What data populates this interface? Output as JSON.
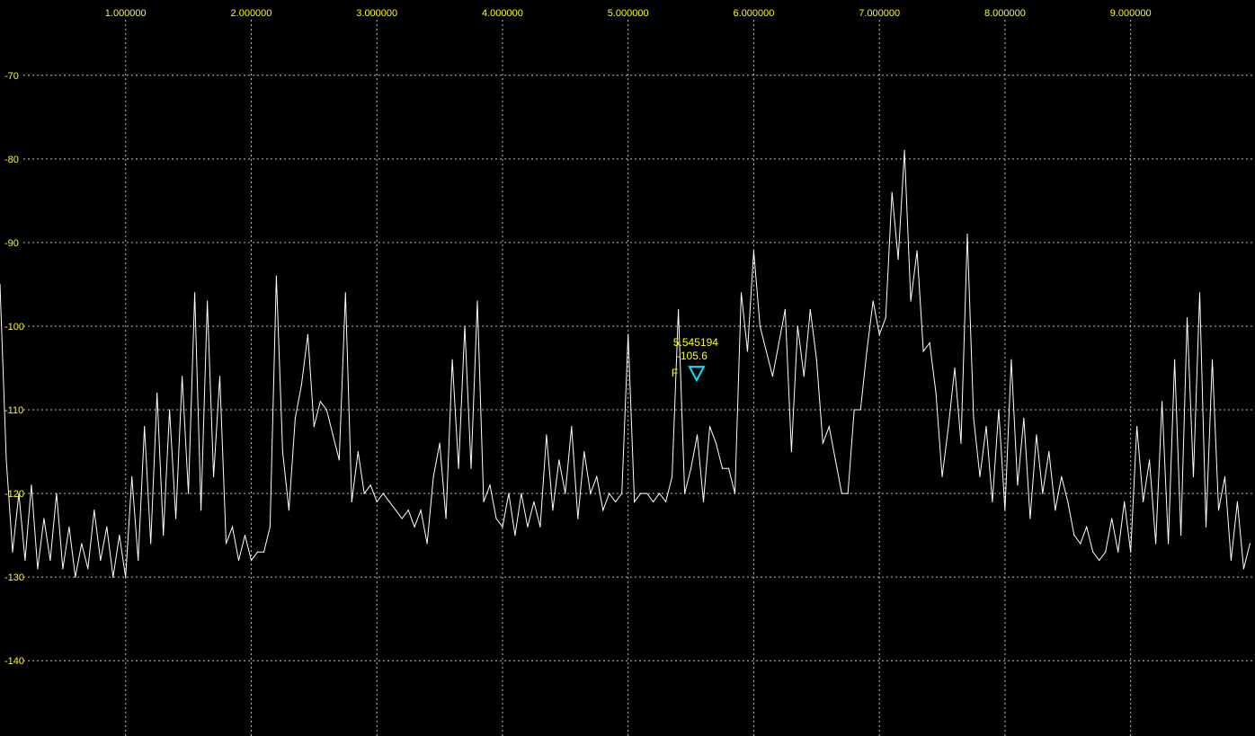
{
  "chart_data": {
    "type": "line",
    "title": "",
    "xlabel": "",
    "ylabel": "",
    "xlim": [
      0.0,
      9.99
    ],
    "ylim": [
      -149.0,
      -61.0
    ],
    "grid": true,
    "x_ticks": [
      "1.000000",
      "2.000000",
      "3.000000",
      "4.000000",
      "5.000000",
      "6.000000",
      "7.000000",
      "8.000000",
      "9.000000"
    ],
    "y_ticks": [
      "-70",
      "-80",
      "-90",
      "-100",
      "-110",
      "-120",
      "-130",
      "-140"
    ],
    "colors": {
      "background": "#000000",
      "trace": "#ffffff",
      "grid": "#bdbdbd",
      "ticks": "#ffff00",
      "marker": "#00e5ff",
      "marker_text": "#ffff00"
    },
    "series": [
      {
        "x": [
          0.0,
          0.05,
          0.1,
          0.15,
          0.2,
          0.25,
          0.3,
          0.35,
          0.4,
          0.45,
          0.5,
          0.55,
          0.6,
          0.65,
          0.7,
          0.75,
          0.8,
          0.85,
          0.9,
          0.95,
          1.0,
          1.05,
          1.1,
          1.15,
          1.2,
          1.25,
          1.3,
          1.35,
          1.4,
          1.45,
          1.5,
          1.55,
          1.6,
          1.65,
          1.7,
          1.75,
          1.8,
          1.85,
          1.9,
          1.95,
          2.0,
          2.05,
          2.1,
          2.15,
          2.2,
          2.25,
          2.3,
          2.35,
          2.4,
          2.45,
          2.5,
          2.55,
          2.6,
          2.65,
          2.7,
          2.75,
          2.8,
          2.85,
          2.9,
          2.95,
          3.0,
          3.05,
          3.1,
          3.15,
          3.2,
          3.25,
          3.3,
          3.35,
          3.4,
          3.45,
          3.5,
          3.55,
          3.6,
          3.65,
          3.7,
          3.75,
          3.8,
          3.85,
          3.9,
          3.95,
          4.0,
          4.05,
          4.1,
          4.15,
          4.2,
          4.25,
          4.3,
          4.35,
          4.4,
          4.45,
          4.5,
          4.55,
          4.6,
          4.65,
          4.7,
          4.75,
          4.8,
          4.85,
          4.9,
          4.95,
          5.0,
          5.05,
          5.1,
          5.15,
          5.2,
          5.25,
          5.3,
          5.35,
          5.4,
          5.45,
          5.5,
          5.55,
          5.6,
          5.65,
          5.7,
          5.75,
          5.8,
          5.85,
          5.9,
          5.95,
          6.0,
          6.05,
          6.1,
          6.15,
          6.2,
          6.25,
          6.3,
          6.35,
          6.4,
          6.45,
          6.5,
          6.55,
          6.6,
          6.65,
          6.7,
          6.75,
          6.8,
          6.85,
          6.9,
          6.95,
          7.0,
          7.05,
          7.1,
          7.15,
          7.2,
          7.25,
          7.3,
          7.35,
          7.4,
          7.45,
          7.5,
          7.55,
          7.6,
          7.65,
          7.7,
          7.75,
          7.8,
          7.85,
          7.9,
          7.95,
          8.0,
          8.05,
          8.1,
          8.15,
          8.2,
          8.25,
          8.3,
          8.35,
          8.4,
          8.45,
          8.5,
          8.55,
          8.6,
          8.65,
          8.7,
          8.75,
          8.8,
          8.85,
          8.9,
          8.95,
          9.0,
          9.05,
          9.1,
          9.15,
          9.2,
          9.25,
          9.3,
          9.35,
          9.4,
          9.45,
          9.5,
          9.55,
          9.6,
          9.65,
          9.7,
          9.75,
          9.8,
          9.85,
          9.9,
          9.95
        ],
        "y": [
          -95,
          -116,
          -127,
          -120,
          -128,
          -119,
          -129,
          -123,
          -128,
          -120,
          -129,
          -124,
          -130,
          -126,
          -129,
          -122,
          -128,
          -124,
          -130,
          -125,
          -130,
          -118,
          -128,
          -112,
          -126,
          -108,
          -125,
          -110,
          -123,
          -106,
          -120,
          -96,
          -122,
          -97,
          -118,
          -106,
          -126,
          -124,
          -128,
          -125,
          -128,
          -127,
          -127,
          -124,
          -94,
          -115,
          -122,
          -111,
          -107,
          -101,
          -112,
          -109,
          -110,
          -113,
          -116,
          -96,
          -121,
          -115,
          -120,
          -119,
          -121,
          -120,
          -121,
          -122,
          -123,
          -122,
          -124,
          -122,
          -126,
          -118,
          -114,
          -123,
          -104,
          -117,
          -100,
          -117,
          -97,
          -121,
          -119,
          -123,
          -124,
          -120,
          -125,
          -120,
          -124,
          -121,
          -124,
          -113,
          -122,
          -116,
          -120,
          -112,
          -123,
          -115,
          -120,
          -118,
          -122,
          -120,
          -121,
          -120,
          -101,
          -121,
          -120,
          -120,
          -121,
          -120,
          -121,
          -118,
          -98,
          -120,
          -117,
          -113,
          -121,
          -112,
          -114,
          -117,
          -117,
          -120,
          -96,
          -103,
          -91,
          -100,
          -103,
          -106,
          -102,
          -98,
          -115,
          -100,
          -106,
          -98,
          -104,
          -114,
          -112,
          -116,
          -120,
          -120,
          -110,
          -110,
          -103,
          -97,
          -101,
          -99,
          -84,
          -92,
          -79,
          -97,
          -91,
          -103,
          -102,
          -108,
          -118,
          -112,
          -105,
          -114,
          -89,
          -111,
          -118,
          -112,
          -121,
          -110,
          -122,
          -104,
          -119,
          -111,
          -123,
          -113,
          -120,
          -115,
          -122,
          -118,
          -121,
          -125,
          -126,
          -124,
          -127,
          -128,
          -127,
          -123,
          -127,
          -121,
          -127,
          -112,
          -121,
          -116,
          -126,
          -109,
          -126,
          -104,
          -125,
          -99,
          -118,
          -96,
          -124,
          -104,
          -122,
          -118,
          -128,
          -121,
          -129,
          -126
        ]
      }
    ],
    "marker": {
      "label": "F",
      "freq": "5.545194",
      "level": "-105.6",
      "x": 5.545194,
      "y": -105.6
    }
  }
}
